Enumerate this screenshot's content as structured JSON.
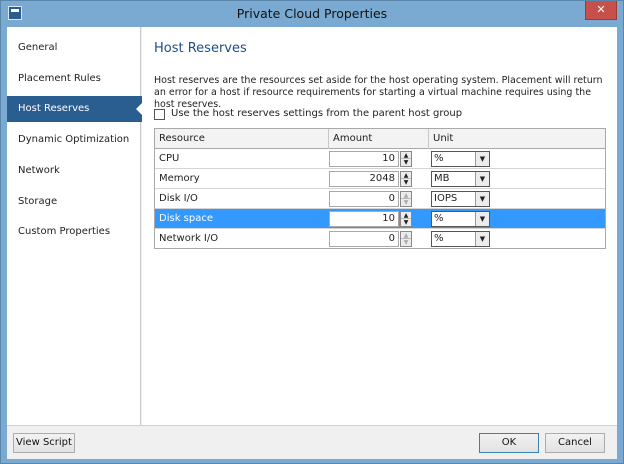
{
  "window": {
    "title": "Private Cloud Properties",
    "close_glyph": "✕"
  },
  "sidebar": {
    "items": [
      {
        "label": "General"
      },
      {
        "label": "Placement Rules"
      },
      {
        "label": "Host Reserves",
        "active": true
      },
      {
        "label": "Dynamic Optimization"
      },
      {
        "label": "Network"
      },
      {
        "label": "Storage"
      },
      {
        "label": "Custom Properties"
      }
    ]
  },
  "main": {
    "heading": "Host Reserves",
    "description": "Host reserves are the resources set aside for the host operating system.  Placement will return an error for a host if resource requirements for starting a virtual machine requires using the host reserves.",
    "checkbox_label": "Use the host reserves settings from the parent host group",
    "checkbox_checked": false,
    "columns": [
      "Resource",
      "Amount",
      "Unit"
    ],
    "rows": [
      {
        "resource": "CPU",
        "amount": "10",
        "unit": "%",
        "selected": false
      },
      {
        "resource": "Memory",
        "amount": "2048",
        "unit": "MB",
        "selected": false
      },
      {
        "resource": "Disk I/O",
        "amount": "0",
        "unit": "IOPS",
        "selected": false
      },
      {
        "resource": "Disk space",
        "amount": "10",
        "unit": "%",
        "selected": true
      },
      {
        "resource": "Network I/O",
        "amount": "0",
        "unit": "%",
        "selected": false
      }
    ]
  },
  "footer": {
    "view_script": "View Script",
    "ok": "OK",
    "cancel": "Cancel"
  },
  "colors": {
    "title_bar": "#7aaad2",
    "nav_active": "#2a5d90",
    "row_selected": "#3399ff",
    "heading": "#1e4e87"
  }
}
